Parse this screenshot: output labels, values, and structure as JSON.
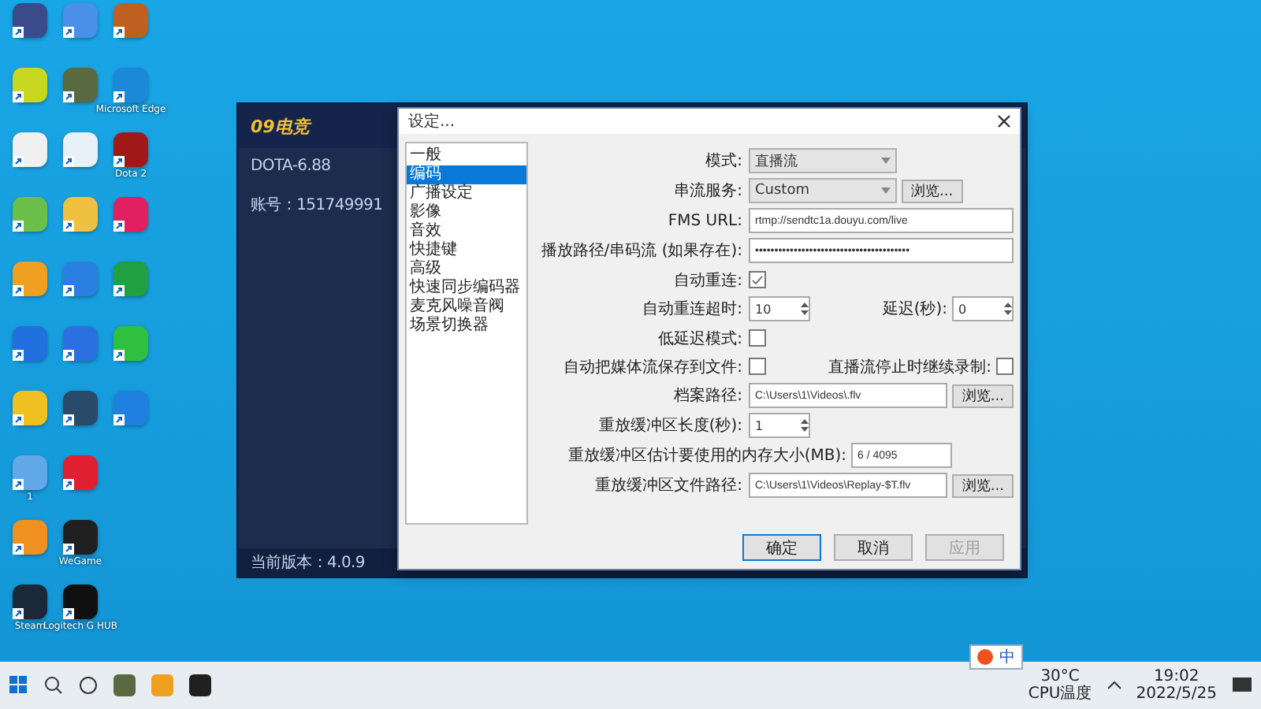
{
  "desktop_icons": [
    {
      "color": "#3a4a8a"
    },
    {
      "color": "#c8d820"
    },
    {
      "color": "#f0f0f0"
    },
    {
      "color": "#6cc04a"
    },
    {
      "color": "#f0a020"
    },
    {
      "color": "#2070e0"
    },
    {
      "color": "#f0c020"
    },
    {
      "color": "#60a8e8",
      "label": "1"
    },
    {
      "color": "#f09020"
    },
    {
      "color": "#1b2838",
      "label": "Steam"
    },
    {
      "color": "#4a90e8"
    },
    {
      "color": "#5a6a40"
    },
    {
      "color": "#e8f0f8"
    },
    {
      "color": "#f0c040"
    },
    {
      "color": "#2a80e0"
    },
    {
      "color": "#2a70e0"
    },
    {
      "color": "#2a4a6a"
    },
    {
      "color": "#e02030"
    },
    {
      "color": "#202020",
      "label": "WeGame"
    },
    {
      "color": "#101010",
      "label": "Logitech G HUB"
    },
    {
      "color": "#c06020"
    },
    {
      "color": "#1a8ad8",
      "label": "Microsoft Edge"
    },
    {
      "color": "#a01818",
      "label": "Dota 2"
    },
    {
      "color": "#e02060"
    },
    {
      "color": "#20a040"
    },
    {
      "color": "#30c040"
    },
    {
      "color": "#2080e0"
    }
  ],
  "app_window": {
    "logo": "09电竞",
    "game": "DOTA-6.88",
    "account": "账号：151749991",
    "version": "当前版本：4.0.9"
  },
  "dialog": {
    "title": "设定...",
    "categories": [
      {
        "label": "一般",
        "selected": false
      },
      {
        "label": "编码",
        "selected": true
      },
      {
        "label": "广播设定",
        "selected": false
      },
      {
        "label": "影像",
        "selected": false
      },
      {
        "label": "音效",
        "selected": false
      },
      {
        "label": "快捷键",
        "selected": false
      },
      {
        "label": "高级",
        "selected": false
      },
      {
        "label": "快速同步编码器",
        "selected": false
      },
      {
        "label": "麦克风噪音阀",
        "selected": false
      },
      {
        "label": "场景切换器",
        "selected": false
      }
    ],
    "rows": [
      {
        "kind": "select",
        "label": "模式:",
        "value": "直播流"
      },
      {
        "kind": "select",
        "label": "串流服务:",
        "value": "Custom",
        "button": "浏览..."
      },
      {
        "kind": "text",
        "label": "FMS URL:",
        "value": "rtmp://sendtc1a.douyu.com/live"
      },
      {
        "kind": "text",
        "label": "播放路径/串码流 (如果存在):",
        "value": "••••••••••••••••••••••••••••••••••••••••"
      },
      {
        "kind": "checkbox",
        "label": "自动重连:",
        "checked": true
      },
      {
        "kind": "spinners",
        "label": "自动重连超时:",
        "value": "10",
        "label_2": "延迟(秒):",
        "value_2": "0"
      },
      {
        "kind": "checkbox",
        "label": "低延迟模式:",
        "checked": false
      },
      {
        "kind": "checkboxes",
        "label": "自动把媒体流保存到文件:",
        "checked": false,
        "label_2": "直播流停止时继续录制:",
        "checked_2": false
      },
      {
        "kind": "text",
        "label": "档案路径:",
        "value": "C:\\Users\\1\\Videos\\.flv",
        "button": "浏览..."
      },
      {
        "kind": "spinner",
        "label": "重放缓冲区长度(秒):",
        "value": "1"
      },
      {
        "kind": "readout",
        "label": "重放缓冲区估计要使用的内存大小(MB):",
        "value": "6 / 4095"
      },
      {
        "kind": "text",
        "label": "重放缓冲区文件路径:",
        "value": "C:\\Users\\1\\Videos\\Replay-$T.flv",
        "button": "浏览..."
      }
    ],
    "buttons": [
      {
        "label": "确定",
        "disabled": false
      },
      {
        "label": "取消",
        "disabled": false
      },
      {
        "label": "应用",
        "disabled": true
      }
    ]
  },
  "ime_bar": {
    "mode": "中"
  },
  "tray": {
    "temperature": "30°C",
    "sensor": "CPU温度",
    "time": "19:02",
    "date": "2022/5/25"
  }
}
